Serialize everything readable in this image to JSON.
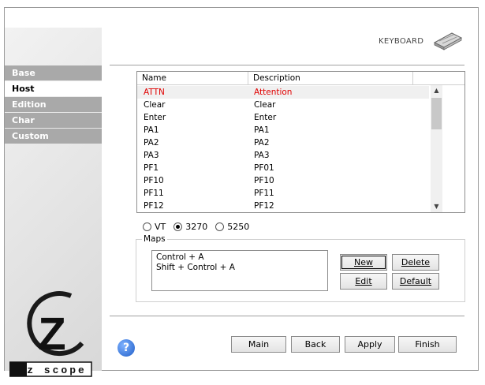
{
  "sidebar": {
    "items": [
      {
        "label": "Base",
        "active": false
      },
      {
        "label": "Host",
        "active": true
      },
      {
        "label": "Edition",
        "active": false
      },
      {
        "label": "Char",
        "active": false
      },
      {
        "label": "Custom",
        "active": false
      }
    ],
    "logo_letter": "Z",
    "logo_text": "z scope"
  },
  "header": {
    "keyboard_label": "KEYBOARD",
    "keyboard_icon": "keyboard-icon"
  },
  "table": {
    "columns": [
      "Name",
      "Description"
    ],
    "rows": [
      {
        "name": "ATTN",
        "desc": "Attention",
        "selected": true
      },
      {
        "name": "Clear",
        "desc": "Clear"
      },
      {
        "name": "Enter",
        "desc": "Enter"
      },
      {
        "name": "PA1",
        "desc": "PA1"
      },
      {
        "name": "PA2",
        "desc": "PA2"
      },
      {
        "name": "PA3",
        "desc": "PA3"
      },
      {
        "name": "PF1",
        "desc": "PF01"
      },
      {
        "name": "PF10",
        "desc": "PF10"
      },
      {
        "name": "PF11",
        "desc": "PF11"
      },
      {
        "name": "PF12",
        "desc": "PF12"
      }
    ]
  },
  "terminal_types": {
    "options": [
      "VT",
      "3270",
      "5250"
    ],
    "selected": "3270"
  },
  "maps": {
    "legend": "Maps",
    "items": [
      "Control + A",
      "Shift + Control + A"
    ],
    "buttons": {
      "new": "New",
      "delete": "Delete",
      "edit": "Edit",
      "default": "Default"
    }
  },
  "footer": {
    "help": "?",
    "main": "Main",
    "back": "Back",
    "apply": "Apply",
    "finish": "Finish"
  },
  "colors": {
    "selected_text": "#e00000",
    "nav_bg": "#a9a9a9"
  }
}
